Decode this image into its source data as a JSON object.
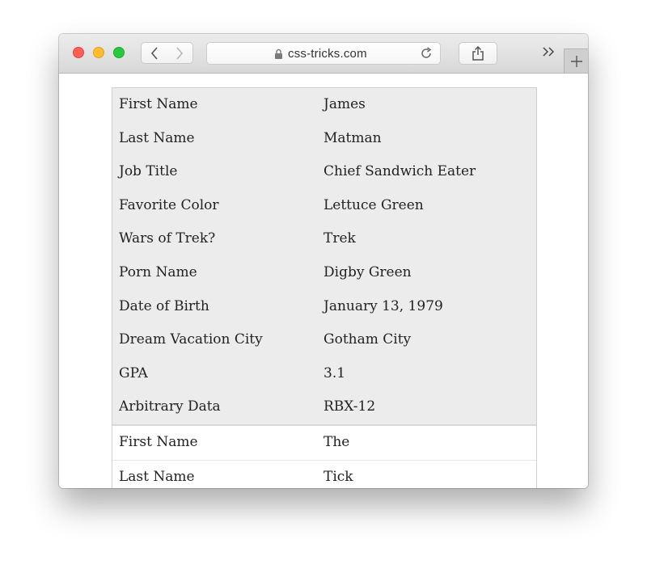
{
  "browser": {
    "url": "css-tricks.com",
    "buttons": {
      "back": "chevron-left-icon",
      "forward": "chevron-right-icon",
      "reload": "reload-icon",
      "share": "share-icon",
      "overflow": "double-chevron-right-icon",
      "new_tab": "plus-icon"
    }
  },
  "table": {
    "group1": [
      {
        "label": "First Name",
        "value": "James"
      },
      {
        "label": "Last Name",
        "value": "Matman"
      },
      {
        "label": "Job Title",
        "value": "Chief Sandwich Eater"
      },
      {
        "label": "Favorite Color",
        "value": "Lettuce Green"
      },
      {
        "label": "Wars of Trek?",
        "value": "Trek"
      },
      {
        "label": "Porn Name",
        "value": "Digby Green"
      },
      {
        "label": "Date of Birth",
        "value": "January 13, 1979"
      },
      {
        "label": "Dream Vacation City",
        "value": "Gotham City"
      },
      {
        "label": "GPA",
        "value": "3.1"
      },
      {
        "label": "Arbitrary Data",
        "value": "RBX-12"
      }
    ],
    "group2": [
      {
        "label": "First Name",
        "value": "The"
      },
      {
        "label": "Last Name",
        "value": "Tick"
      }
    ]
  }
}
